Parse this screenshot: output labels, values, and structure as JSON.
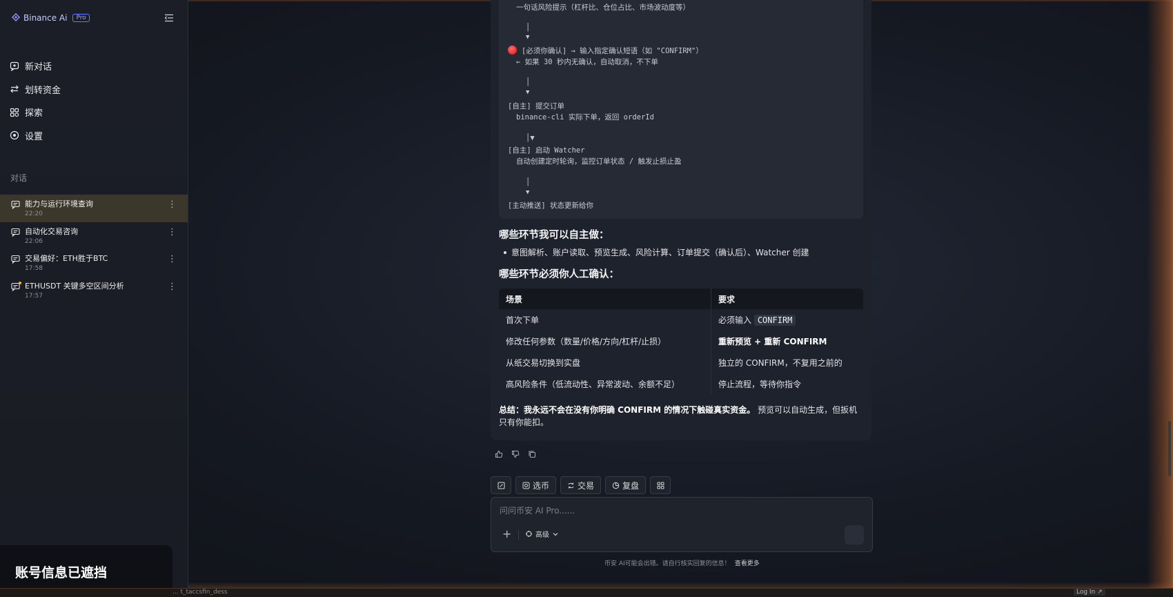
{
  "brand": {
    "name": "Binance Ai",
    "badge": "Pro"
  },
  "nav": [
    {
      "label": "新对话",
      "icon": "new-chat-icon"
    },
    {
      "label": "划转资金",
      "icon": "transfer-icon"
    },
    {
      "label": "探索",
      "icon": "explore-icon"
    },
    {
      "label": "设置",
      "icon": "settings-icon"
    }
  ],
  "conversations_label": "对话",
  "conversations": [
    {
      "title": "能力与运行环境查询",
      "time": "22:20",
      "active": true
    },
    {
      "title": "自动化交易咨询",
      "time": "22:06"
    },
    {
      "title": "交易偏好：ETH胜于BTC",
      "time": "17:58"
    },
    {
      "title": "ETHUSDT 关键多空区间分析",
      "time": "17:57"
    }
  ],
  "account_notice": "账号信息已遮挡",
  "flow": {
    "l1": "一句话风险提示（杠杆比、仓位占比、市场波动度等）",
    "l2": "│",
    "l3": "▼",
    "l4": "[必须你确认] → 输入指定确认短语（如 \"CONFIRM\"）",
    "l5": "← 如果 30 秒内无确认，自动取消，不下单",
    "l6": "│",
    "l7": "▼",
    "l8": "[自主] 提交订单",
    "l9": "binance-cli 实际下单，返回 orderId",
    "l10": "│▼",
    "l11": "[自主] 启动 Watcher",
    "l12": "自动创建定时轮询，监控订单状态 / 触发止损止盈",
    "l13": "│",
    "l14": "▼",
    "l15": "[主动推送] 状态更新给你"
  },
  "autonomous_heading": "哪些环节我可以自主做：",
  "autonomous_bullet": "意图解析、账户读取、预览生成、风险计算、订单提交（确认后）、Watcher 创建",
  "manual_heading": "哪些环节必须你人工确认：",
  "table": {
    "headers": [
      "场景",
      "要求"
    ],
    "rows": [
      {
        "scene": "首次下单",
        "req_prefix": "必须输入 ",
        "req_code": "CONFIRM"
      },
      {
        "scene": "修改任何参数（数量/价格/方向/杠杆/止损）",
        "req_bold": "重新预览 + 重新 CONFIRM"
      },
      {
        "scene": "从纸交易切换到实盘",
        "req": "独立的 CONFIRM，不复用之前的"
      },
      {
        "scene": "高风险条件（低流动性、异常波动、余额不足）",
        "req": "停止流程，等待你指令"
      }
    ]
  },
  "summary": {
    "bold": "总结：我永远不会在没有你明确 CONFIRM 的情况下触碰真实资金。",
    "rest": "预览可以自动生成，但扳机只有你能扣。"
  },
  "quick_actions": [
    "选币",
    "交易",
    "复盘"
  ],
  "composer": {
    "placeholder": "问问币安 AI Pro......",
    "advanced": "高级"
  },
  "disclaimer": {
    "text": "币安 AI可能会出错。请自行核实回复的信息！",
    "link": "查看更多"
  },
  "bottom_strip": {
    "cmd": "... t_taccsfin_dess",
    "login": "Log In ↗"
  },
  "colors": {
    "accent": "#f0b90b",
    "brand": "#6c77ff",
    "active_row": "#3b382b"
  }
}
